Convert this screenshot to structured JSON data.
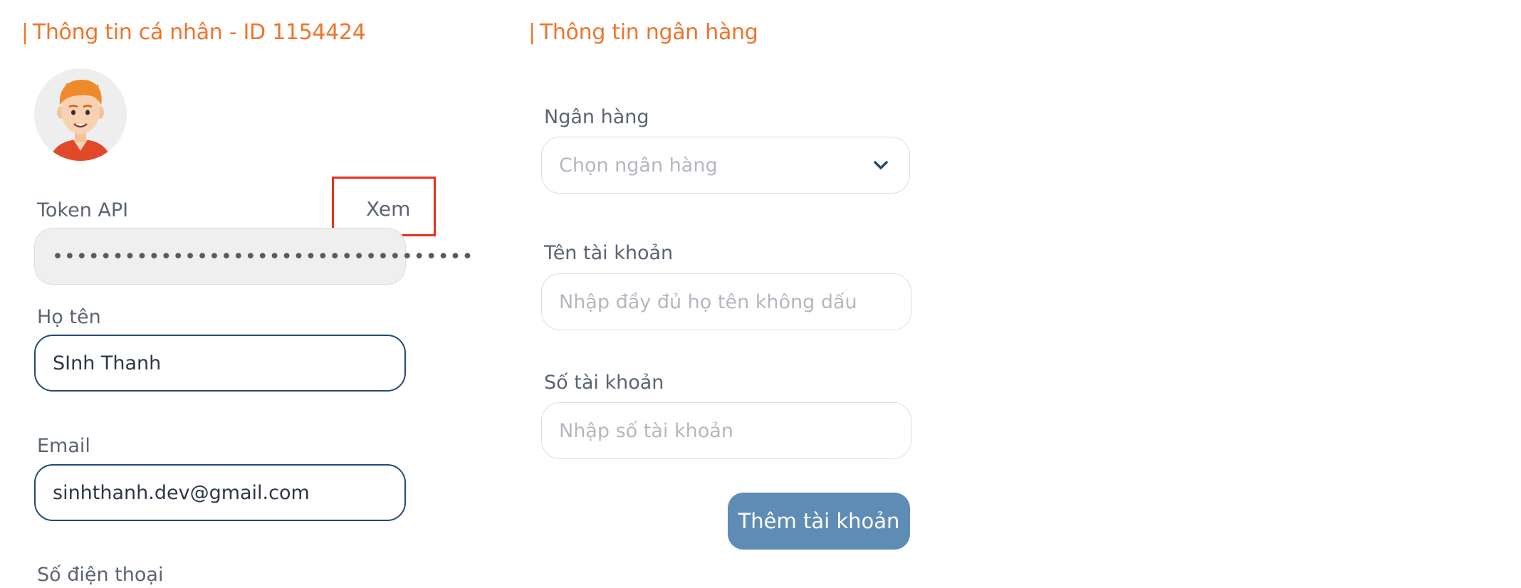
{
  "personal": {
    "title": "Thông tin cá nhân - ID 1154424",
    "token_label": "Token API",
    "token_view_link": "Xem",
    "token_masked": "•••••••••••••••••••••••••••••••••••",
    "name_label": "Họ tên",
    "name_value": "SInh Thanh",
    "email_label": "Email",
    "email_value": "sinhthanh.dev@gmail.com",
    "phone_label": "Số điện thoại"
  },
  "bank": {
    "title": "Thông tin ngân hàng",
    "bank_label": "Ngân hàng",
    "bank_placeholder": "Chọn ngân hàng",
    "account_name_label": "Tên tài khoản",
    "account_name_placeholder": "Nhập đầy đủ họ tên không dấu",
    "account_number_label": "Số tài khoản",
    "account_number_placeholder": "Nhập số tài khoản",
    "add_button": "Thêm tài khoản"
  },
  "colors": {
    "accent_orange": "#f0732a",
    "input_active_border": "#1e4a78",
    "button_bg": "#5f8cb4",
    "highlight_red": "#e8301c"
  },
  "icons": {
    "avatar": "user-avatar-icon",
    "dropdown": "chevron-down-icon"
  }
}
